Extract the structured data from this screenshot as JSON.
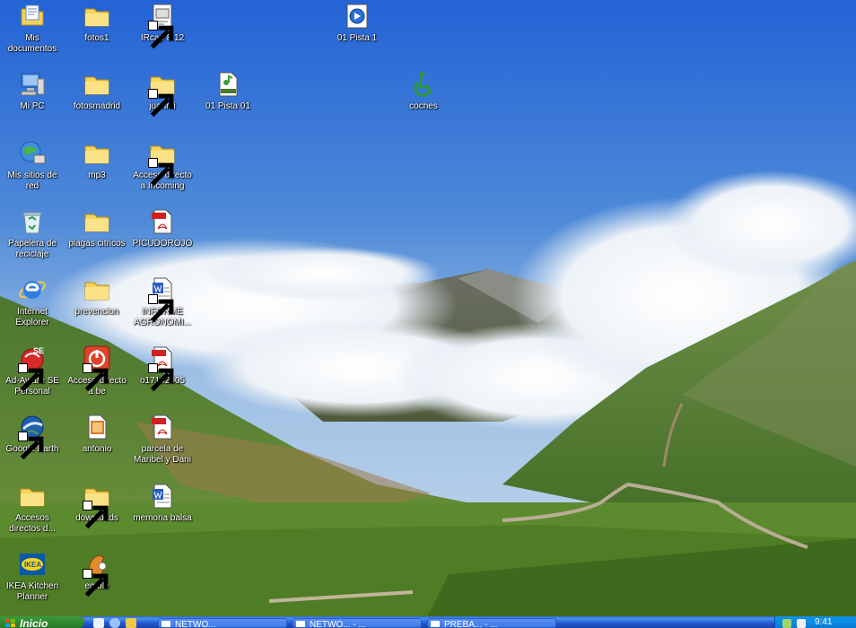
{
  "desktop": {
    "icons": [
      {
        "id": "misdoc",
        "label": "Mis documentos",
        "icon": "my-documents-icon"
      },
      {
        "id": "fotos1",
        "label": "fotos1",
        "icon": "folder-icon"
      },
      {
        "id": "ircap",
        "label": "IRcap 8.12",
        "icon": "ircap-shortcut-icon"
      },
      {
        "id": "pista1",
        "label": "01 Pista 1",
        "icon": "media-player-icon"
      },
      {
        "id": "mipc",
        "label": "Mi PC",
        "icon": "my-computer-icon"
      },
      {
        "id": "fotosm",
        "label": "fotosmadrid",
        "icon": "folder-icon"
      },
      {
        "id": "juanmi",
        "label": "juanmi",
        "icon": "folder-shortcut-icon"
      },
      {
        "id": "pista01",
        "label": "01 Pista 01",
        "icon": "mpeg-file-icon"
      },
      {
        "id": "coches",
        "label": "coches",
        "icon": "accessibility-icon"
      },
      {
        "id": "missitios",
        "label": "Mis sitios de red",
        "icon": "network-places-icon"
      },
      {
        "id": "mp3",
        "label": "mp3",
        "icon": "folder-icon"
      },
      {
        "id": "incoming",
        "label": "Acceso directo a Incoming",
        "icon": "folder-shortcut-icon"
      },
      {
        "id": "papelera",
        "label": "Papelera de reciclaje",
        "icon": "recycle-bin-icon"
      },
      {
        "id": "plagas",
        "label": "plagas citricos",
        "icon": "folder-icon"
      },
      {
        "id": "picudo",
        "label": "PICUDOROJO",
        "icon": "pdf-icon"
      },
      {
        "id": "ie",
        "label": "Internet Explorer",
        "icon": "internet-explorer-icon"
      },
      {
        "id": "prev",
        "label": "prevencion",
        "icon": "folder-icon"
      },
      {
        "id": "informe",
        "label": "INFORME AGRONOMI...",
        "icon": "word-doc-shortcut-icon"
      },
      {
        "id": "adaware",
        "label": "Ad-Aware SE Personal",
        "icon": "adaware-icon"
      },
      {
        "id": "acbe",
        "label": "Acceso directo a be",
        "icon": "red-shortcut-icon"
      },
      {
        "id": "o171",
        "label": "o17102005",
        "icon": "pdf-icon"
      },
      {
        "id": "gearth",
        "label": "Google Earth",
        "icon": "google-earth-icon"
      },
      {
        "id": "antonio",
        "label": "antonio",
        "icon": "image-file-icon"
      },
      {
        "id": "parcela",
        "label": "parcela de Maribel y Dani",
        "icon": "pdf-icon"
      },
      {
        "id": "accesos",
        "label": "Accesos directos d...",
        "icon": "folder-icon"
      },
      {
        "id": "downl",
        "label": "downloads",
        "icon": "folder-shortcut-icon"
      },
      {
        "id": "memoria",
        "label": "memoria balsa",
        "icon": "word-doc-icon"
      },
      {
        "id": "ikea",
        "label": "IKEA Kitchen Planner",
        "icon": "ikea-icon"
      },
      {
        "id": "emule",
        "label": "emule",
        "icon": "emule-icon"
      }
    ]
  },
  "taskbar": {
    "start_label": "Inicio",
    "tasks": [
      {
        "label": "NETWO..."
      },
      {
        "label": "NETWO... - ..."
      },
      {
        "label": "PREBA... - ..."
      }
    ],
    "clock": "9:41"
  },
  "colors": {
    "sky_top": "#2565d8",
    "sky_bottom": "#9dc0e6",
    "grass": "#5c8a2e",
    "taskbar": "#2459d6",
    "start_green": "#2f8a2f"
  }
}
